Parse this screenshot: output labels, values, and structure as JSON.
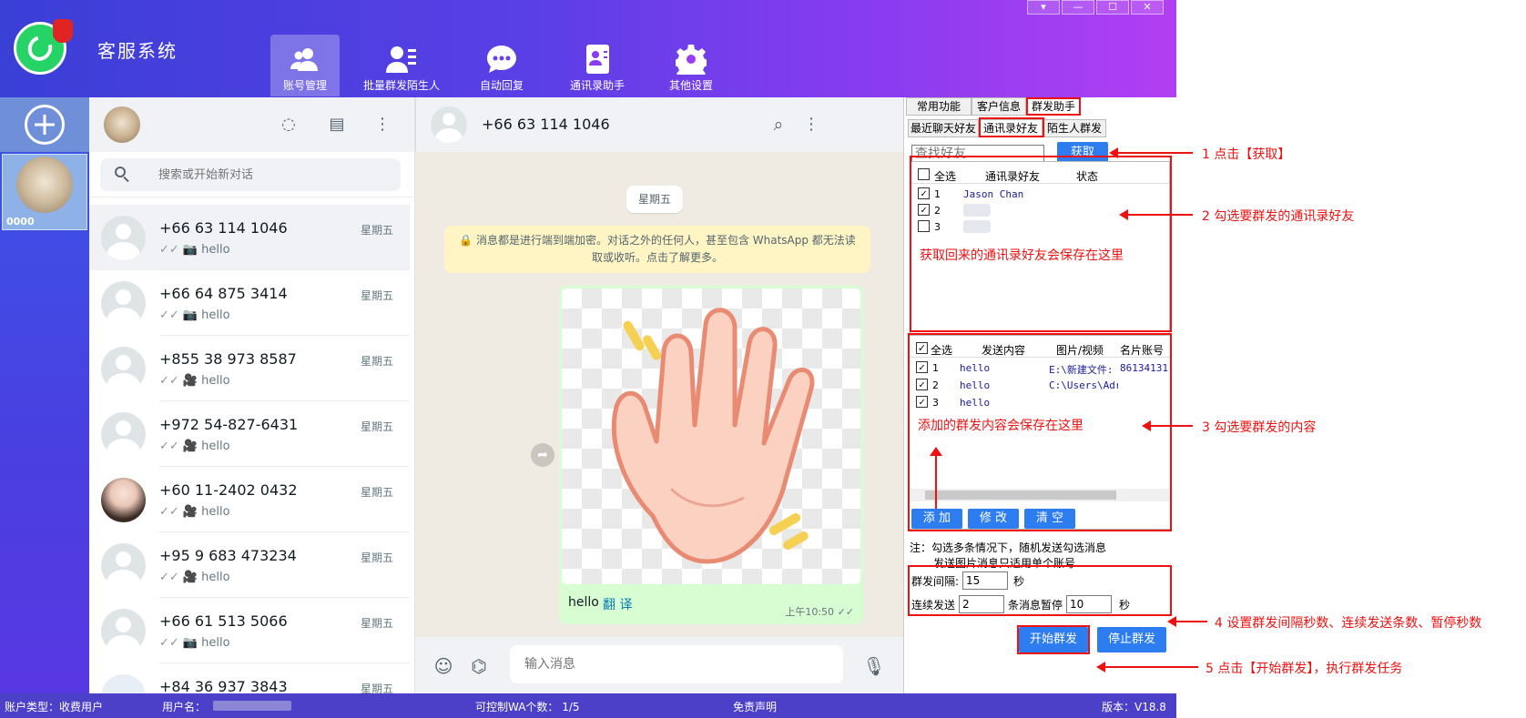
{
  "app": {
    "title": "客服系统"
  },
  "window_controls": [
    "▾",
    "—",
    "☐",
    "✕"
  ],
  "nav": [
    {
      "label": "账号管理",
      "icon": "users-icon",
      "active": true
    },
    {
      "label": "批量群发陌生人",
      "icon": "user-list-icon",
      "active": false
    },
    {
      "label": "自动回复",
      "icon": "chat-dots-icon",
      "active": false
    },
    {
      "label": "通讯录助手",
      "icon": "contact-book-icon",
      "active": false
    },
    {
      "label": "其他设置",
      "icon": "gear-icon",
      "active": false
    }
  ],
  "account": {
    "name": "0000"
  },
  "chatlist": {
    "search_placeholder": "搜索或开始新对话",
    "chats": [
      {
        "name": "+66 63 114 1046",
        "time": "星期五",
        "media": "📷",
        "preview": "hello",
        "avatar": "default"
      },
      {
        "name": "+66 64 875 3414",
        "time": "星期五",
        "media": "📷",
        "preview": "hello",
        "avatar": "default"
      },
      {
        "name": "+855 38 973 8587",
        "time": "星期五",
        "media": "🎥",
        "preview": "hello",
        "avatar": "default"
      },
      {
        "name": "+972 54-827-6431",
        "time": "星期五",
        "media": "🎥",
        "preview": "hello",
        "avatar": "default"
      },
      {
        "name": "+60 11-2402 0432",
        "time": "星期五",
        "media": "🎥",
        "preview": "hello",
        "avatar": "photo"
      },
      {
        "name": "+95 9 683 473234",
        "time": "星期五",
        "media": "🎥",
        "preview": "hello",
        "avatar": "default"
      },
      {
        "name": "+66 61 513 5066",
        "time": "星期五",
        "media": "📷",
        "preview": "hello",
        "avatar": "default"
      },
      {
        "name": "+84 36 937 3843",
        "time": "星期五",
        "media": "",
        "preview": "",
        "avatar": "cartoon"
      }
    ]
  },
  "conversation": {
    "name": "+66 63 114 1046",
    "day": "星期五",
    "encryption_notice": "🔒 消息都是进行端到端加密。对话之外的任何人，甚至包含 WhatsApp 都无法读取或收听。点击了解更多。",
    "message_text": "hello",
    "translate_label": "翻 译",
    "message_time": "上午10:50",
    "composer_placeholder": "输入消息"
  },
  "panel": {
    "tabs": [
      "常用功能",
      "客户信息",
      "群发助手"
    ],
    "subtabs": [
      "最近聊天好友",
      "通讯录好友",
      "陌生人群发"
    ],
    "find_placeholder": "查找好友",
    "fetch_button": "获取",
    "contacts_header": [
      "全选",
      "通讯录好友",
      "状态"
    ],
    "contacts": [
      {
        "idx": "1",
        "name": "Jason Chan",
        "checked": true
      },
      {
        "idx": "2",
        "name": "",
        "checked": true
      },
      {
        "idx": "3",
        "name": "",
        "checked": false
      }
    ],
    "contacts_note": "获取回来的通讯录好友会保存在这里",
    "content_header": [
      "全选",
      "发送内容",
      "图片/视频",
      "名片账号"
    ],
    "contents": [
      {
        "idx": "1",
        "text": "hello",
        "media": "E:\\新建文件:",
        "card": "86134131",
        "checked": true
      },
      {
        "idx": "2",
        "text": "hello",
        "media": "C:\\Users\\Adr",
        "card": "",
        "checked": true
      },
      {
        "idx": "3",
        "text": "hello",
        "media": "",
        "card": "",
        "checked": true
      }
    ],
    "contents_note": "添加的群发内容会保存在这里",
    "add_button": "添 加",
    "edit_button": "修 改",
    "clear_button": "清 空",
    "notice_line1": "注：勾选多条情况下，随机发送勾选消息",
    "notice_line2": "发送图片消息只适用单个账号",
    "interval_label": "群发间隔:",
    "interval_value": "15",
    "interval_unit": "秒",
    "continuous_label": "连续发送",
    "continuous_value": "2",
    "pause_label": "条消息暂停",
    "pause_value": "10",
    "pause_unit": "秒",
    "start_button": "开始群发",
    "stop_button": "停止群发"
  },
  "annotations": [
    "1 点击【获取】",
    "2 勾选要群发的通讯录好友",
    "3 勾选要群发的内容",
    "4 设置群发间隔秒数、连续发送条数、暂停秒数",
    "5 点击【开始群发】，执行群发任务"
  ],
  "statusbar": {
    "account_type": "账户类型：收费用户",
    "username_label": "用户名：",
    "controllable": "可控制WA个数：  1/5",
    "disclaimer": "免责声明",
    "version": "版本：V18.8"
  },
  "colors": {
    "accent": "#2d7cf0",
    "annotation": "#ee1111",
    "topbar_start": "#3a3fd6",
    "topbar_end": "#b23ff2"
  }
}
